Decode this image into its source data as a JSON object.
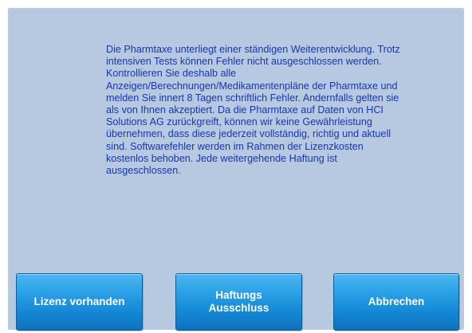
{
  "disclaimer": {
    "text": "Die Pharmtaxe unterliegt einer ständigen Weiterentwicklung. Trotz\nintensiven Tests können Fehler nicht ausgeschlossen werden.\nKontrollieren Sie deshalb alle\nAnzeigen/Berechnungen/Medikamentenpläne der Pharmtaxe und\nmelden Sie innert 8 Tagen schriftlich Fehler. Andernfalls gelten sie\nals von Ihnen akzeptiert. Da die Pharmtaxe auf Daten von HCI\nSolutions AG zurückgreift, können wir keine Gewährleistung\nübernehmen, dass diese jederzeit vollständig, richtig und aktuell\nsind. Softwarefehler werden im Rahmen der Lizenzkosten\nkostenlos behoben. Jede weitergehende Haftung ist\nausgeschlossen."
  },
  "buttons": {
    "license_label": "Lizenz vorhanden",
    "liability_label": "Haftungs\nAusschluss",
    "cancel_label": "Abbrechen"
  },
  "colors": {
    "panel_background": "#b7c9e1",
    "text": "#1636b0",
    "button_top": "#4fb6f1",
    "button_bottom": "#0d72bd"
  }
}
